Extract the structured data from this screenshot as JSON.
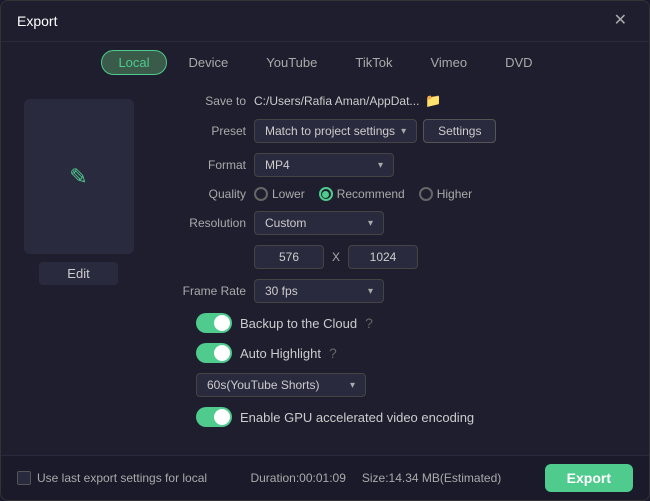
{
  "window": {
    "title": "Export",
    "close_label": "✕"
  },
  "tabs": [
    {
      "label": "Local",
      "active": true
    },
    {
      "label": "Device",
      "active": false
    },
    {
      "label": "YouTube",
      "active": false
    },
    {
      "label": "TikTok",
      "active": false
    },
    {
      "label": "Vimeo",
      "active": false
    },
    {
      "label": "DVD",
      "active": false
    }
  ],
  "preview": {
    "edit_label": "Edit"
  },
  "form": {
    "save_to_label": "Save to",
    "save_to_path": "C:/Users/Rafia Aman/AppDat...",
    "preset_label": "Preset",
    "preset_value": "Match to project settings",
    "settings_btn": "Settings",
    "format_label": "Format",
    "format_value": "MP4",
    "quality_label": "Quality",
    "quality_options": [
      {
        "label": "Lower",
        "selected": false
      },
      {
        "label": "Recommend",
        "selected": true
      },
      {
        "label": "Higher",
        "selected": false
      }
    ],
    "resolution_label": "Resolution",
    "resolution_value": "Custom",
    "resolution_w": "576",
    "resolution_x": "X",
    "resolution_h": "1024",
    "frame_rate_label": "Frame Rate",
    "frame_rate_value": "30 fps",
    "backup_label": "Backup to the Cloud",
    "auto_highlight_label": "Auto Highlight",
    "highlight_duration_value": "60s(YouTube Shorts)",
    "gpu_label": "Enable GPU accelerated video encoding"
  },
  "footer": {
    "checkbox_label": "Use last export settings for local",
    "duration_label": "Duration:00:01:09",
    "size_label": "Size:14.34 MB(Estimated)",
    "export_btn": "Export"
  },
  "icons": {
    "folder": "📁",
    "chevron": "▾",
    "info": "?"
  }
}
